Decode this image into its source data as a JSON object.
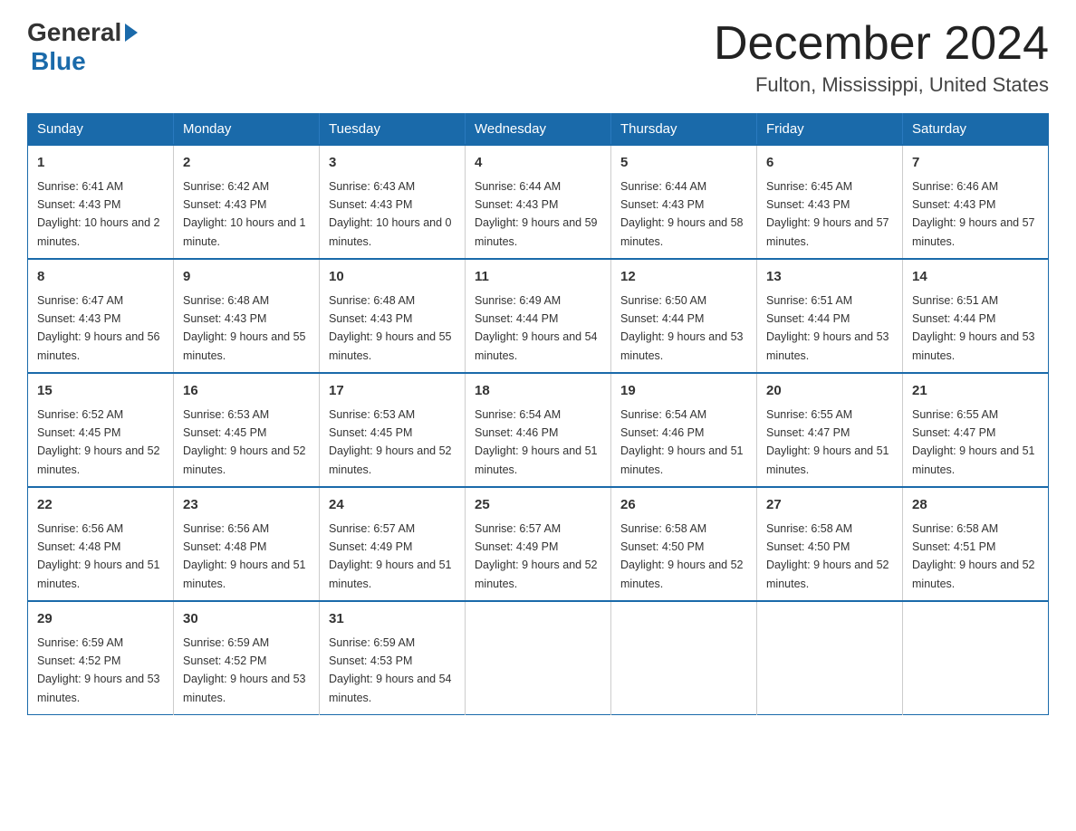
{
  "logo": {
    "general": "General",
    "blue": "Blue"
  },
  "header": {
    "title": "December 2024",
    "subtitle": "Fulton, Mississippi, United States"
  },
  "weekdays": [
    "Sunday",
    "Monday",
    "Tuesday",
    "Wednesday",
    "Thursday",
    "Friday",
    "Saturday"
  ],
  "weeks": [
    [
      {
        "day": "1",
        "sunrise": "6:41 AM",
        "sunset": "4:43 PM",
        "daylight": "10 hours and 2 minutes."
      },
      {
        "day": "2",
        "sunrise": "6:42 AM",
        "sunset": "4:43 PM",
        "daylight": "10 hours and 1 minute."
      },
      {
        "day": "3",
        "sunrise": "6:43 AM",
        "sunset": "4:43 PM",
        "daylight": "10 hours and 0 minutes."
      },
      {
        "day": "4",
        "sunrise": "6:44 AM",
        "sunset": "4:43 PM",
        "daylight": "9 hours and 59 minutes."
      },
      {
        "day": "5",
        "sunrise": "6:44 AM",
        "sunset": "4:43 PM",
        "daylight": "9 hours and 58 minutes."
      },
      {
        "day": "6",
        "sunrise": "6:45 AM",
        "sunset": "4:43 PM",
        "daylight": "9 hours and 57 minutes."
      },
      {
        "day": "7",
        "sunrise": "6:46 AM",
        "sunset": "4:43 PM",
        "daylight": "9 hours and 57 minutes."
      }
    ],
    [
      {
        "day": "8",
        "sunrise": "6:47 AM",
        "sunset": "4:43 PM",
        "daylight": "9 hours and 56 minutes."
      },
      {
        "day": "9",
        "sunrise": "6:48 AM",
        "sunset": "4:43 PM",
        "daylight": "9 hours and 55 minutes."
      },
      {
        "day": "10",
        "sunrise": "6:48 AM",
        "sunset": "4:43 PM",
        "daylight": "9 hours and 55 minutes."
      },
      {
        "day": "11",
        "sunrise": "6:49 AM",
        "sunset": "4:44 PM",
        "daylight": "9 hours and 54 minutes."
      },
      {
        "day": "12",
        "sunrise": "6:50 AM",
        "sunset": "4:44 PM",
        "daylight": "9 hours and 53 minutes."
      },
      {
        "day": "13",
        "sunrise": "6:51 AM",
        "sunset": "4:44 PM",
        "daylight": "9 hours and 53 minutes."
      },
      {
        "day": "14",
        "sunrise": "6:51 AM",
        "sunset": "4:44 PM",
        "daylight": "9 hours and 53 minutes."
      }
    ],
    [
      {
        "day": "15",
        "sunrise": "6:52 AM",
        "sunset": "4:45 PM",
        "daylight": "9 hours and 52 minutes."
      },
      {
        "day": "16",
        "sunrise": "6:53 AM",
        "sunset": "4:45 PM",
        "daylight": "9 hours and 52 minutes."
      },
      {
        "day": "17",
        "sunrise": "6:53 AM",
        "sunset": "4:45 PM",
        "daylight": "9 hours and 52 minutes."
      },
      {
        "day": "18",
        "sunrise": "6:54 AM",
        "sunset": "4:46 PM",
        "daylight": "9 hours and 51 minutes."
      },
      {
        "day": "19",
        "sunrise": "6:54 AM",
        "sunset": "4:46 PM",
        "daylight": "9 hours and 51 minutes."
      },
      {
        "day": "20",
        "sunrise": "6:55 AM",
        "sunset": "4:47 PM",
        "daylight": "9 hours and 51 minutes."
      },
      {
        "day": "21",
        "sunrise": "6:55 AM",
        "sunset": "4:47 PM",
        "daylight": "9 hours and 51 minutes."
      }
    ],
    [
      {
        "day": "22",
        "sunrise": "6:56 AM",
        "sunset": "4:48 PM",
        "daylight": "9 hours and 51 minutes."
      },
      {
        "day": "23",
        "sunrise": "6:56 AM",
        "sunset": "4:48 PM",
        "daylight": "9 hours and 51 minutes."
      },
      {
        "day": "24",
        "sunrise": "6:57 AM",
        "sunset": "4:49 PM",
        "daylight": "9 hours and 51 minutes."
      },
      {
        "day": "25",
        "sunrise": "6:57 AM",
        "sunset": "4:49 PM",
        "daylight": "9 hours and 52 minutes."
      },
      {
        "day": "26",
        "sunrise": "6:58 AM",
        "sunset": "4:50 PM",
        "daylight": "9 hours and 52 minutes."
      },
      {
        "day": "27",
        "sunrise": "6:58 AM",
        "sunset": "4:50 PM",
        "daylight": "9 hours and 52 minutes."
      },
      {
        "day": "28",
        "sunrise": "6:58 AM",
        "sunset": "4:51 PM",
        "daylight": "9 hours and 52 minutes."
      }
    ],
    [
      {
        "day": "29",
        "sunrise": "6:59 AM",
        "sunset": "4:52 PM",
        "daylight": "9 hours and 53 minutes."
      },
      {
        "day": "30",
        "sunrise": "6:59 AM",
        "sunset": "4:52 PM",
        "daylight": "9 hours and 53 minutes."
      },
      {
        "day": "31",
        "sunrise": "6:59 AM",
        "sunset": "4:53 PM",
        "daylight": "9 hours and 54 minutes."
      },
      null,
      null,
      null,
      null
    ]
  ]
}
